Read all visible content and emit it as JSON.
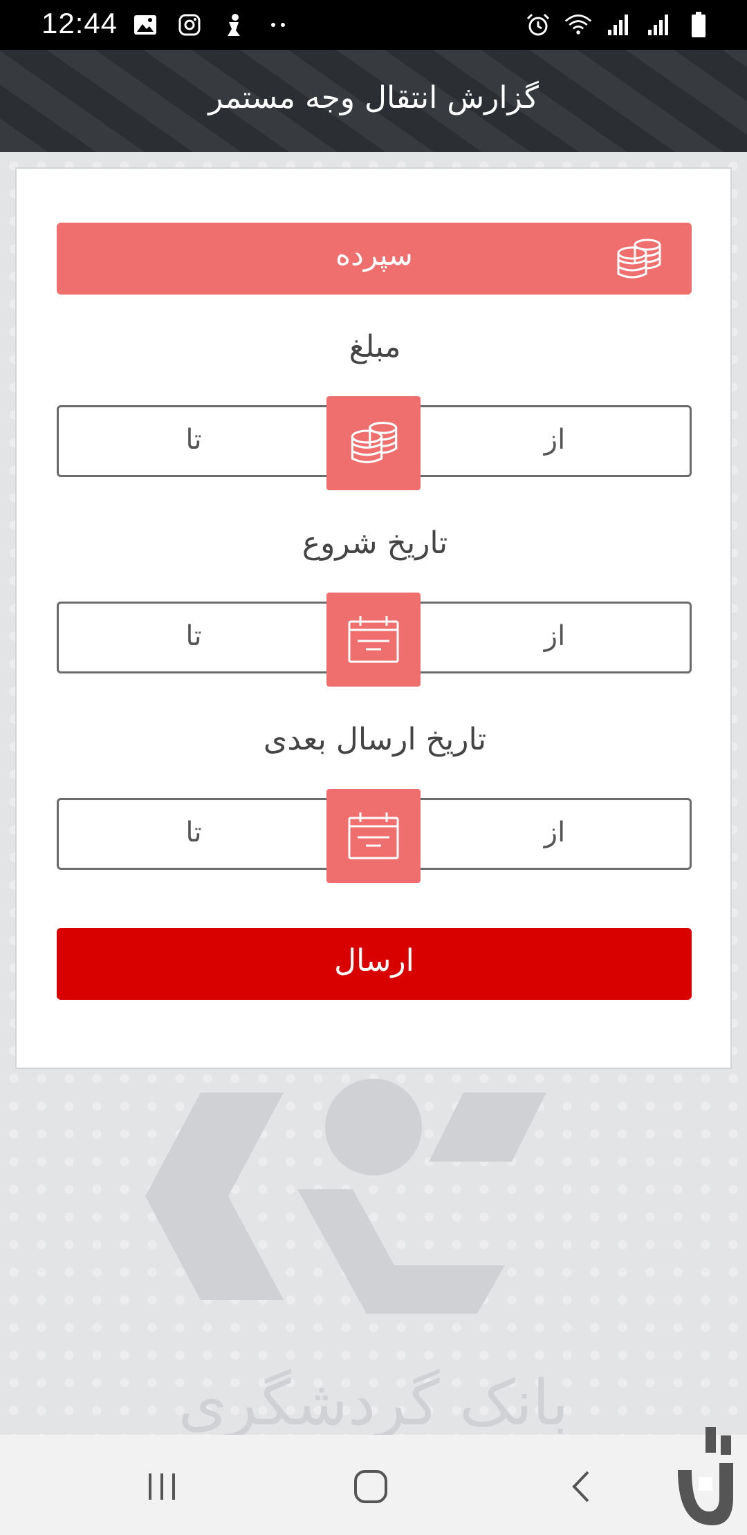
{
  "status_bar": {
    "time": "12:44",
    "left_icons": [
      "image-icon",
      "instagram-icon",
      "app-notification-icon",
      "more-dots-icon"
    ],
    "right_icons": [
      "alarm-icon",
      "wifi-icon",
      "signal-icon",
      "signal-icon",
      "battery-icon"
    ]
  },
  "header": {
    "title": "گزارش انتقال وجه مستمر"
  },
  "account": {
    "label": "سپرده",
    "icon": "coins-icon"
  },
  "amount": {
    "label": "مبلغ",
    "from": "از",
    "to": "تا",
    "icon": "coins-icon"
  },
  "start_date": {
    "label": "تاریخ شروع",
    "from": "از",
    "to": "تا",
    "icon": "calendar-icon"
  },
  "next_send_date": {
    "label": "تاریخ ارسال بعدی",
    "from": "از",
    "to": "تا",
    "icon": "calendar-icon"
  },
  "submit": {
    "label": "ارسال"
  },
  "watermark": {
    "text": "بانک گردشگری"
  },
  "colors": {
    "accent": "#ef6f6f",
    "submit": "#d90000",
    "header": "#2f3237"
  },
  "nav_bar": {
    "buttons": [
      "recent-apps-icon",
      "home-icon",
      "back-icon"
    ]
  }
}
